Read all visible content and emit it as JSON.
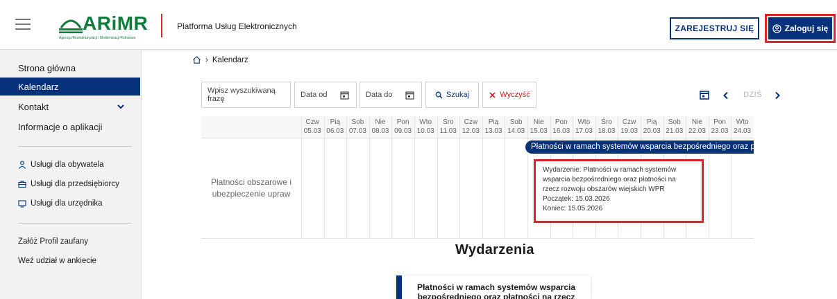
{
  "header": {
    "menu_icon": "hamburger-icon",
    "logo_text": "ARiMR",
    "logo_subtitle": "Agencja Restrukturyzacji i Modernizacji Rolnictwa",
    "platform_title": "Platforma Usług Elektronicznych",
    "register_label": "ZAREJESTRUJ SIĘ",
    "login_label": "Zaloguj się",
    "brand_colors": {
      "green": "#0c7d3b",
      "navy": "#07317a",
      "red": "#d9252a"
    }
  },
  "sidebar": {
    "items": [
      {
        "label": "Strona główna"
      },
      {
        "label": "Kalendarz"
      },
      {
        "label": "Kontakt"
      },
      {
        "label": "Informacje o aplikacji"
      }
    ],
    "services": [
      {
        "label": "Usługi dla obywatela",
        "icon": "person-icon"
      },
      {
        "label": "Usługi dla przedsiębiorcy",
        "icon": "briefcase-icon"
      },
      {
        "label": "Usługi dla urzędnika",
        "icon": "monitor-icon"
      }
    ],
    "links": [
      {
        "label": "Załóż Profil zaufany"
      },
      {
        "label": "Weź udział w ankiecie"
      }
    ]
  },
  "breadcrumb": {
    "home_icon": "home-icon",
    "current": "Kalendarz"
  },
  "filters": {
    "search_placeholder": "Wpisz wyszukiwaną frazę",
    "date_from": "Data od",
    "date_to": "Data do",
    "search_button": "Szukaj",
    "clear_button": "Wyczyść"
  },
  "navigation": {
    "today_label": "DZIŚ"
  },
  "timeline": {
    "days": [
      {
        "name": "Czw",
        "date": "05.03"
      },
      {
        "name": "Pią",
        "date": "06.03"
      },
      {
        "name": "Sob",
        "date": "07.03"
      },
      {
        "name": "Nie",
        "date": "08.03"
      },
      {
        "name": "Pon",
        "date": "09.03"
      },
      {
        "name": "Wto",
        "date": "10.03"
      },
      {
        "name": "Śro",
        "date": "11.03"
      },
      {
        "name": "Czw",
        "date": "12.03"
      },
      {
        "name": "Pią",
        "date": "13.03"
      },
      {
        "name": "Sob",
        "date": "14.03"
      },
      {
        "name": "Nie",
        "date": "15.03"
      },
      {
        "name": "Pon",
        "date": "16.03"
      },
      {
        "name": "Wto",
        "date": "17.03"
      },
      {
        "name": "Śro",
        "date": "18.03"
      },
      {
        "name": "Czw",
        "date": "19.03"
      },
      {
        "name": "Pią",
        "date": "20.03"
      },
      {
        "name": "Sob",
        "date": "21.03"
      },
      {
        "name": "Nie",
        "date": "22.03"
      },
      {
        "name": "Pon",
        "date": "23.03"
      },
      {
        "name": "Wto",
        "date": "24.03"
      }
    ],
    "row_label": "Płatności obszarowe i ubezpieczenie upraw",
    "event_bar": "Płatności w ramach systemów wsparcia bezpośredniego oraz płatności na rzecz rozwoju obszarów wiejskich WPR",
    "tooltip": {
      "line1": "Wydarzenie: Płatności w ramach systemów",
      "line2": "wsparcia bezpośredniego oraz płatności na",
      "line3": "rzecz rozwoju obszarów wiejskich WPR",
      "start": "Początek: 15.03.2026",
      "end": "Koniec: 15.05.2026"
    }
  },
  "events": {
    "title": "Wydarzenia",
    "card_line1": "Płatności w ramach systemów wsparcia",
    "card_line2": "bezpośredniego oraz płatności na rzecz"
  }
}
